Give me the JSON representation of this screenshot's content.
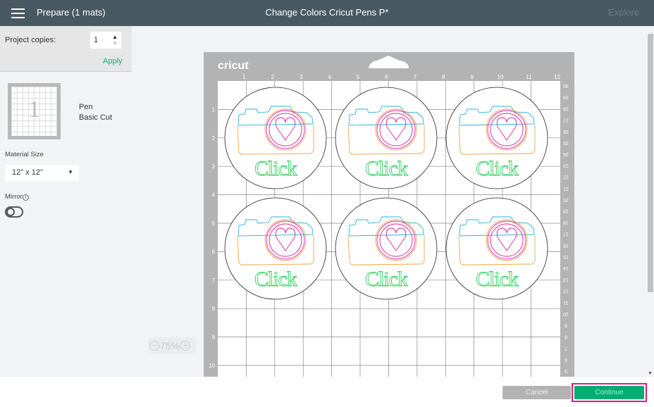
{
  "header": {
    "title": "Prepare (1 mats)",
    "document_title": "Change Colors Cricut Pens P*",
    "explore_label": "Explore"
  },
  "left_panel": {
    "project_copies_label": "Project copies:",
    "project_copies_value": "1",
    "apply_label": "Apply",
    "mat_thumbnail_number": "1",
    "mat_tool": "Pen",
    "mat_cut": "Basic Cut",
    "material_size_label": "Material Size",
    "material_size_value": "12\" x 12\"",
    "mirror_label": "Mirror",
    "mirror_on": false
  },
  "mat": {
    "brand": "cricut",
    "top_ruler": [
      "1",
      "2",
      "3",
      "4",
      "5",
      "6",
      "7",
      "8",
      "9",
      "10",
      "11",
      "12"
    ],
    "left_ruler": [
      "1",
      "2",
      "3",
      "4",
      "5",
      "6",
      "7",
      "8",
      "9",
      "10"
    ],
    "right_ruler": [
      "30",
      "29",
      "28",
      "27",
      "26",
      "25",
      "24",
      "23",
      "22",
      "21",
      "20",
      "19",
      "18",
      "17",
      "16",
      "15",
      "14",
      "13",
      "12",
      "11",
      "10",
      "9",
      "8",
      "7",
      "6",
      "5"
    ],
    "design_text": "Click",
    "colors": {
      "camera_top": "#2fb3d6",
      "camera_body": "#f0a64a",
      "lens": "#e0219a",
      "text": "#35d160",
      "outline": "#222222"
    }
  },
  "zoom": {
    "value": "75%",
    "minus": "−",
    "plus": "+"
  },
  "footer": {
    "cancel_label": "Cancel",
    "continue_label": "Continue"
  },
  "colors": {
    "header": "#495961",
    "accent": "#00ae72",
    "highlight": "#e5168c"
  }
}
